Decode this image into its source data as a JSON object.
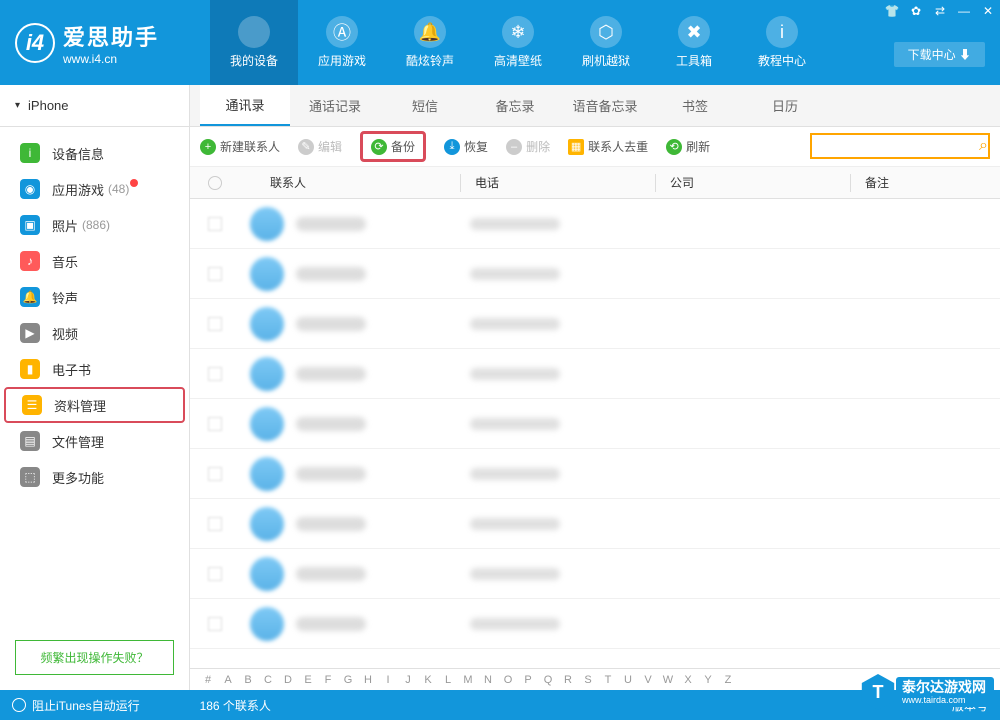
{
  "app": {
    "title": "爱思助手",
    "url": "www.i4.cn"
  },
  "window_controls": [
    "👕",
    "✿",
    "⇄",
    "—",
    "✕"
  ],
  "download_center": "下载中心 ⬇",
  "top_nav": [
    {
      "label": "我的设备",
      "glyph": ""
    },
    {
      "label": "应用游戏",
      "glyph": "Ⓐ"
    },
    {
      "label": "酷炫铃声",
      "glyph": "🔔"
    },
    {
      "label": "高清壁纸",
      "glyph": "❄"
    },
    {
      "label": "刷机越狱",
      "glyph": "⬡"
    },
    {
      "label": "工具箱",
      "glyph": "✖"
    },
    {
      "label": "教程中心",
      "glyph": "i"
    }
  ],
  "sub_tabs": [
    "通讯录",
    "通话记录",
    "短信",
    "备忘录",
    "语音备忘录",
    "书签",
    "日历"
  ],
  "device_name": "iPhone",
  "sidebar": [
    {
      "label": "设备信息",
      "icon": "i",
      "color": "#3fb837"
    },
    {
      "label": "应用游戏",
      "icon": "◉",
      "color": "#1296db",
      "count": "(48)",
      "dot": true
    },
    {
      "label": "照片",
      "icon": "▣",
      "color": "#1296db",
      "count": "(886)"
    },
    {
      "label": "音乐",
      "icon": "♪",
      "color": "#ff5a5a"
    },
    {
      "label": "铃声",
      "icon": "🔔",
      "color": "#1296db"
    },
    {
      "label": "视频",
      "icon": "▶",
      "color": "#888"
    },
    {
      "label": "电子书",
      "icon": "▮",
      "color": "#ffb400"
    },
    {
      "label": "资料管理",
      "icon": "☰",
      "color": "#ffb400",
      "selected": true
    },
    {
      "label": "文件管理",
      "icon": "▤",
      "color": "#888"
    },
    {
      "label": "更多功能",
      "icon": "⬚",
      "color": "#888"
    }
  ],
  "help_link": "频繁出现操作失败？",
  "toolbar": {
    "new": "新建联系人",
    "edit": "编辑",
    "backup": "备份",
    "restore": "恢复",
    "delete": "删除",
    "dedupe": "联系人去重",
    "refresh": "刷新"
  },
  "columns": {
    "contact": "联系人",
    "phone": "电话",
    "company": "公司",
    "note": "备注"
  },
  "letters": [
    "#",
    "A",
    "B",
    "C",
    "D",
    "E",
    "F",
    "G",
    "H",
    "I",
    "J",
    "K",
    "L",
    "M",
    "N",
    "O",
    "P",
    "Q",
    "R",
    "S",
    "T",
    "U",
    "V",
    "W",
    "X",
    "Y",
    "Z"
  ],
  "status": {
    "itunes": "阻止iTunes自动运行",
    "count": "186 个联系人",
    "version": "版本号"
  },
  "watermark": {
    "name": "泰尔达游戏网",
    "url": "www.tairda.com"
  },
  "contact_rows": 9
}
